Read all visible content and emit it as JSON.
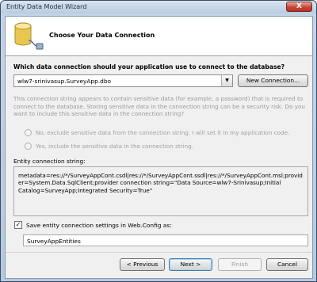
{
  "window": {
    "title": "Entity Data Model Wizard",
    "close_glyph": "X"
  },
  "header": {
    "title": "Choose Your Data Connection",
    "icon": "database-connection-icon"
  },
  "question": "Which data connection should your application use to connect to the database?",
  "connection": {
    "selected": "wlw7-srinivasup.SurveyApp.dbo",
    "new_connection_label": "New Connection..."
  },
  "sensitive_notice": "This connection string appears to contain sensitive data (for example, a password) that is required to connect to the database. Storing sensitive data in the connection string can be a security risk. Do you want to include this sensitive data in the connection string?",
  "radio_no": "No, exclude sensitive data from the connection string. I will set it in my application code.",
  "radio_yes": "Yes, include the sensitive data in the connection string.",
  "ecs": {
    "label": "Entity connection string:",
    "value": "metadata=res://*/SurveyAppCont.csdl|res://*/SurveyAppCont.ssdl|res://*/SurveyAppCont.msl;provider=System.Data.SqlClient;provider connection string=\"Data Source=wlw7-Srinivasup;Initial Catalog=SurveyApp;Integrated Security=True\""
  },
  "save_settings": {
    "checked": true,
    "label": "Save entity connection settings in Web.Config as:",
    "value": "SurveyAppEntities"
  },
  "buttons": {
    "previous": "< Previous",
    "next": "Next >",
    "finish": "Finish",
    "cancel": "Cancel"
  }
}
